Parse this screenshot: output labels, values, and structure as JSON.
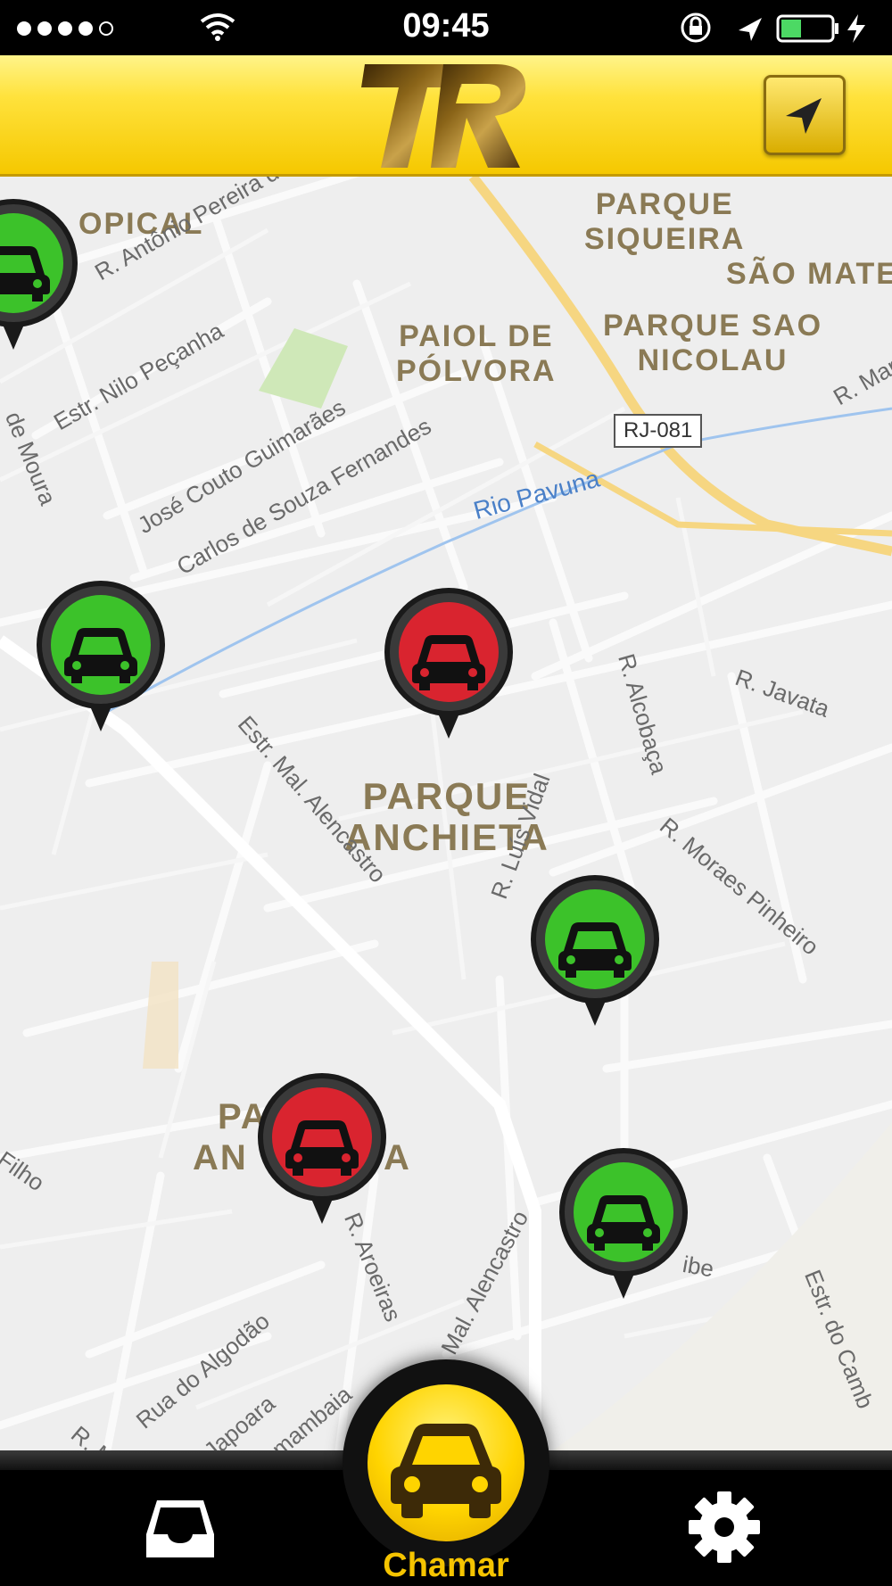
{
  "status_bar": {
    "time": "09:45"
  },
  "header": {
    "locate_icon": "location-arrow-icon"
  },
  "map": {
    "area_labels": [
      "OPICAL",
      "PARQUE SIQUEIRA",
      "SÃO MATE",
      "PAIOL DE PÓLVORA",
      "PARQUE SAO NICOLAU",
      "PARQUE ANCHIETA",
      "PA",
      "AN",
      "A"
    ],
    "street_labels": [
      "R. Antônio Pereira de Carva",
      "Estr. Nilo Peçanha",
      "José Couto Guimarães",
      "Carlos de Souza Fernandes",
      "Estr. Mal. Alencastro",
      "R. Alcobaça",
      "R. Javata",
      "R. Moraes Pinheiro",
      "R. Luís Vidal",
      "R. Aroeiras",
      "Mal. Alencastro",
      "Rua do Algodão",
      "Japoara",
      "mambaia",
      "Estr. do Camb",
      "ibe",
      "Filho",
      "de Moura",
      "R. Mar",
      "R. M"
    ],
    "river_label": "Rio Pavuna",
    "route_badge": "RJ-081",
    "pins": [
      {
        "status": "available",
        "color": "#3cc22a"
      },
      {
        "status": "available",
        "color": "#3cc22a"
      },
      {
        "status": "occupied",
        "color": "#d9242f"
      },
      {
        "status": "available",
        "color": "#3cc22a"
      },
      {
        "status": "occupied",
        "color": "#d9242f"
      },
      {
        "status": "available",
        "color": "#3cc22a"
      }
    ]
  },
  "tab_bar": {
    "call_label": "Chamar",
    "inbox_icon": "inbox-icon",
    "settings_icon": "gear-icon",
    "accent_color": "#f5c400"
  }
}
